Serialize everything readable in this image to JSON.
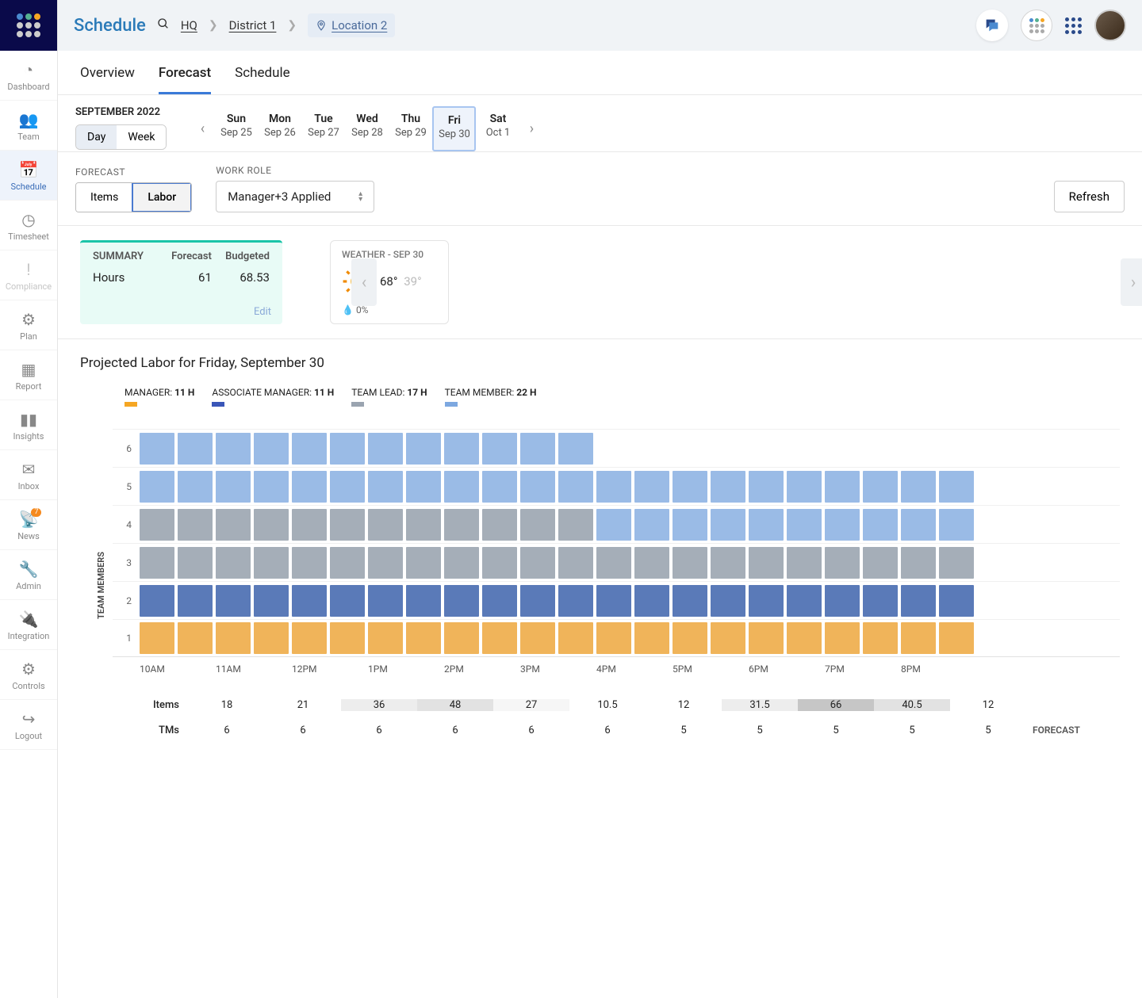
{
  "header": {
    "title": "Schedule",
    "breadcrumb": [
      "HQ",
      "District 1",
      "Location 2"
    ]
  },
  "sidebar": {
    "items": [
      {
        "label": "Dashboard",
        "icon": "◔"
      },
      {
        "label": "Team",
        "icon": "👥"
      },
      {
        "label": "Schedule",
        "icon": "📅",
        "active": true
      },
      {
        "label": "Timesheet",
        "icon": "◷"
      },
      {
        "label": "Compliance",
        "icon": "!",
        "dim": true
      },
      {
        "label": "Plan",
        "icon": "⚙"
      },
      {
        "label": "Report",
        "icon": "▦"
      },
      {
        "label": "Insights",
        "icon": "▮▮"
      },
      {
        "label": "Inbox",
        "icon": "✉"
      },
      {
        "label": "News",
        "icon": "📡",
        "badge": "7"
      },
      {
        "label": "Admin",
        "icon": "🔧"
      },
      {
        "label": "Integration",
        "icon": "🔌"
      },
      {
        "label": "Controls",
        "icon": "⚙"
      },
      {
        "label": "Logout",
        "icon": "↪"
      }
    ]
  },
  "tabs": {
    "items": [
      "Overview",
      "Forecast",
      "Schedule"
    ],
    "active": "Forecast"
  },
  "calendar": {
    "month_label": "SEPTEMBER 2022",
    "view_toggle": [
      "Day",
      "Week"
    ],
    "view_active": "Day",
    "days": [
      {
        "name": "Sun",
        "date": "Sep 25"
      },
      {
        "name": "Mon",
        "date": "Sep 26"
      },
      {
        "name": "Tue",
        "date": "Sep 27"
      },
      {
        "name": "Wed",
        "date": "Sep 28"
      },
      {
        "name": "Thu",
        "date": "Sep 29"
      },
      {
        "name": "Fri",
        "date": "Sep 30",
        "selected": true
      },
      {
        "name": "Sat",
        "date": "Oct 1"
      }
    ]
  },
  "filters": {
    "forecast_label": "FORECAST",
    "forecast_options": [
      "Items",
      "Labor"
    ],
    "forecast_active": "Labor",
    "workrole_label": "WORK ROLE",
    "workrole_value": "Manager+3 Applied",
    "refresh": "Refresh"
  },
  "summary": {
    "title": "SUMMARY",
    "cols": [
      "Forecast",
      "Budgeted"
    ],
    "rows": [
      {
        "label": "Hours",
        "forecast": "61",
        "budgeted": "68.53"
      }
    ],
    "edit": "Edit"
  },
  "weather": {
    "title": "WEATHER - SEP 30",
    "hi": "68°",
    "lo": "39°",
    "precip": "0%"
  },
  "chart": {
    "title": "Projected Labor for Friday, September 30",
    "y_label": "TEAM MEMBERS",
    "legend": [
      {
        "label": "MANAGER:",
        "hours": "11 H",
        "color": "#f5a623"
      },
      {
        "label": "ASSOCIATE MANAGER:",
        "hours": "11 H",
        "color": "#3a56b8"
      },
      {
        "label": "TEAM LEAD:",
        "hours": "17 H",
        "color": "#9aa4b0"
      },
      {
        "label": "TEAM MEMBER:",
        "hours": "22 H",
        "color": "#7da8e0"
      }
    ],
    "x_labels": [
      "10AM",
      "11AM",
      "12PM",
      "1PM",
      "2PM",
      "3PM",
      "4PM",
      "5PM",
      "6PM",
      "7PM",
      "8PM"
    ],
    "rows": [
      {
        "y": 6,
        "color": "#9abbe6",
        "span": [
          0,
          12
        ]
      },
      {
        "y": 5,
        "color": "#9abbe6",
        "span": [
          0,
          22
        ]
      },
      {
        "y": 4,
        "color": "#a5aeb8",
        "span": [
          0,
          22
        ]
      },
      {
        "y": 3,
        "color": "#a5aeb8",
        "span": [
          0,
          22
        ]
      },
      {
        "y": 2,
        "color": "#5a7ab8",
        "span": [
          0,
          22
        ]
      },
      {
        "y": 1,
        "color": "#f0b45a",
        "span": [
          0,
          22
        ]
      }
    ],
    "row4_override": {
      "range": [
        12,
        22
      ],
      "color": "#9abbe6"
    },
    "slots": 22
  },
  "forecast_table": {
    "end_label": "FORECAST",
    "rows": [
      {
        "label": "Items",
        "values": [
          "18",
          "21",
          "36",
          "48",
          "27",
          "10.5",
          "12",
          "31.5",
          "66",
          "40.5",
          "12"
        ],
        "shades": [
          0,
          0,
          2,
          3,
          1,
          0,
          0,
          2,
          5,
          3,
          0
        ]
      },
      {
        "label": "TMs",
        "values": [
          "6",
          "6",
          "6",
          "6",
          "6",
          "6",
          "5",
          "5",
          "5",
          "5",
          "5"
        ]
      }
    ]
  },
  "colors": {
    "tm": "#9abbe6",
    "lead": "#a5aeb8",
    "am": "#5a7ab8",
    "mgr": "#f0b45a"
  }
}
